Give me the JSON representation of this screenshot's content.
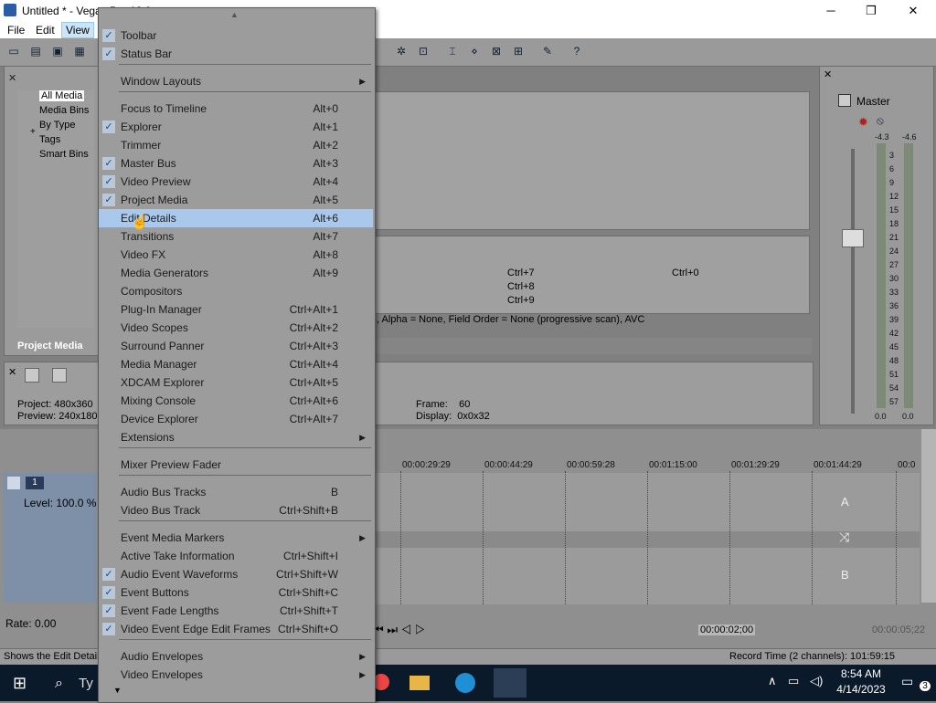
{
  "window": {
    "title": "Untitled * - Vegas Pro 13.0",
    "minimize": "─",
    "maximize": "❐",
    "close": "✕"
  },
  "menubar": {
    "file": "File",
    "edit": "Edit",
    "view": "View"
  },
  "explorer": {
    "tree": [
      "All Media",
      "Media Bins",
      "By Type",
      "Tags",
      "Smart Bins"
    ],
    "tab": "Project Media"
  },
  "project_info": {
    "project_label": "Project:",
    "project_value": "480x360",
    "preview_label": "Preview:",
    "preview_value": "240x180",
    "frame_label": "Frame:",
    "frame_value": "60",
    "display_label": "Display:",
    "display_value": "0x0x32"
  },
  "media_info_text": ", Alpha = None, Field Order = None (progressive scan), AVC",
  "shortcuts_panel": {
    "a": "Ctrl+7",
    "b": "Ctrl+8",
    "c": "Ctrl+9",
    "d": "Ctrl+0"
  },
  "mixer": {
    "title": "Master",
    "peak_left": "-4.3",
    "peak_right": "-4.6",
    "scale": [
      "3",
      "6",
      "9",
      "12",
      "15",
      "18",
      "21",
      "24",
      "27",
      "30",
      "33",
      "36",
      "39",
      "42",
      "45",
      "48",
      "51",
      "54",
      "57"
    ],
    "bottom_left": "0.0",
    "bottom_right": "0.0"
  },
  "timeline": {
    "ruler": [
      "00:00:29:29",
      "00:00:44:29",
      "00:00:59:28",
      "00:01:15:00",
      "00:01:29:29",
      "00:01:44:29",
      "00:0"
    ],
    "track_number": "1",
    "level": "Level: 100.0 %",
    "rate": "Rate: 0.00",
    "marker_a": "A",
    "marker_b": "B",
    "time_current": "00:00:02;00",
    "time_end": "00:00:05;22"
  },
  "statusbar": {
    "left": "Shows the Edit Details",
    "right": "Record Time (2 channels): 101:59:15"
  },
  "taskbar": {
    "search_placeholder": "Ty",
    "time": "8:54 AM",
    "date": "4/14/2023",
    "notif_count": "3"
  },
  "view_menu": {
    "items": [
      {
        "label": "Toolbar",
        "shortcut": "",
        "checked": true
      },
      {
        "label": "Status Bar",
        "shortcut": "",
        "checked": true
      },
      {
        "label": "Window Layouts",
        "shortcut": "",
        "submenu": true
      },
      {
        "label": "Focus to Timeline",
        "shortcut": "Alt+0"
      },
      {
        "label": "Explorer",
        "shortcut": "Alt+1",
        "checked": true
      },
      {
        "label": "Trimmer",
        "shortcut": "Alt+2"
      },
      {
        "label": "Master Bus",
        "shortcut": "Alt+3",
        "checked": true
      },
      {
        "label": "Video Preview",
        "shortcut": "Alt+4",
        "checked": true
      },
      {
        "label": "Project Media",
        "shortcut": "Alt+5",
        "checked": true
      },
      {
        "label": "Edit Details",
        "shortcut": "Alt+6",
        "highlighted": true
      },
      {
        "label": "Transitions",
        "shortcut": "Alt+7"
      },
      {
        "label": "Video FX",
        "shortcut": "Alt+8"
      },
      {
        "label": "Media Generators",
        "shortcut": "Alt+9"
      },
      {
        "label": "Compositors",
        "shortcut": ""
      },
      {
        "label": "Plug-In Manager",
        "shortcut": "Ctrl+Alt+1"
      },
      {
        "label": "Video Scopes",
        "shortcut": "Ctrl+Alt+2"
      },
      {
        "label": "Surround Panner",
        "shortcut": "Ctrl+Alt+3"
      },
      {
        "label": "Media Manager",
        "shortcut": "Ctrl+Alt+4"
      },
      {
        "label": "XDCAM Explorer",
        "shortcut": "Ctrl+Alt+5"
      },
      {
        "label": "Mixing Console",
        "shortcut": "Ctrl+Alt+6"
      },
      {
        "label": "Device Explorer",
        "shortcut": "Ctrl+Alt+7"
      },
      {
        "label": "Extensions",
        "shortcut": "",
        "submenu": true
      },
      {
        "label": "Mixer Preview Fader",
        "shortcut": ""
      },
      {
        "label": "Audio Bus Tracks",
        "shortcut": "B"
      },
      {
        "label": "Video Bus Track",
        "shortcut": "Ctrl+Shift+B"
      },
      {
        "label": "Event Media Markers",
        "shortcut": "",
        "submenu": true
      },
      {
        "label": "Active Take Information",
        "shortcut": "Ctrl+Shift+I"
      },
      {
        "label": "Audio Event Waveforms",
        "shortcut": "Ctrl+Shift+W",
        "checked": true
      },
      {
        "label": "Event Buttons",
        "shortcut": "Ctrl+Shift+C",
        "checked": true
      },
      {
        "label": "Event Fade Lengths",
        "shortcut": "Ctrl+Shift+T",
        "checked": true
      },
      {
        "label": "Video Event Edge Edit Frames",
        "shortcut": "Ctrl+Shift+O",
        "checked": true
      },
      {
        "label": "Audio Envelopes",
        "shortcut": "",
        "submenu": true
      },
      {
        "label": "Video Envelopes",
        "shortcut": "",
        "submenu": true
      }
    ]
  }
}
